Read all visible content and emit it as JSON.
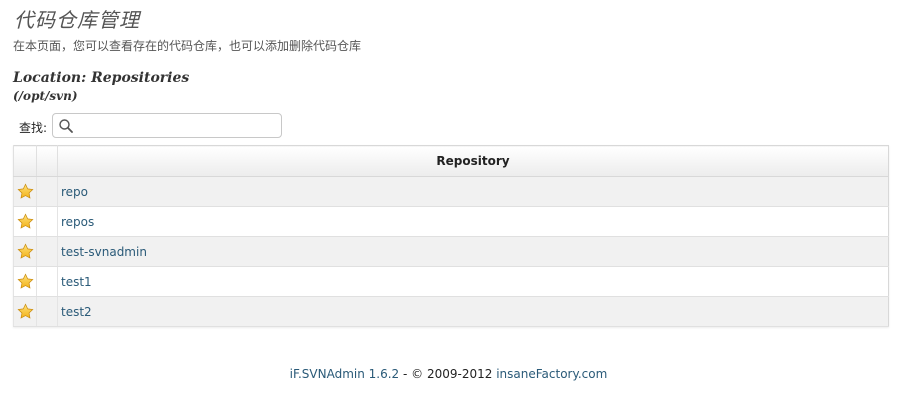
{
  "page": {
    "title": "代码仓库管理",
    "description": "在本页面，您可以查看存在的代码仓库，也可以添加删除代码仓库"
  },
  "location": {
    "title": "Location: Repositories",
    "path": "(/opt/svn)"
  },
  "search": {
    "label": "查找:",
    "value": "",
    "placeholder": "",
    "icon": "search-icon"
  },
  "table": {
    "header": "Repository",
    "rows": [
      {
        "name": "repo",
        "icon": "star-icon"
      },
      {
        "name": "repos",
        "icon": "star-icon"
      },
      {
        "name": "test-svnadmin",
        "icon": "star-icon"
      },
      {
        "name": "test1",
        "icon": "star-icon"
      },
      {
        "name": "test2",
        "icon": "star-icon"
      }
    ]
  },
  "footer": {
    "product_link": "iF.SVNAdmin 1.6.2",
    "separator": " - © 2009-2012 ",
    "company_link": "insaneFactory.com"
  },
  "colors": {
    "link": "#2a5a78",
    "star": "#f2b21b",
    "row_alt": "#f1f1f1"
  }
}
